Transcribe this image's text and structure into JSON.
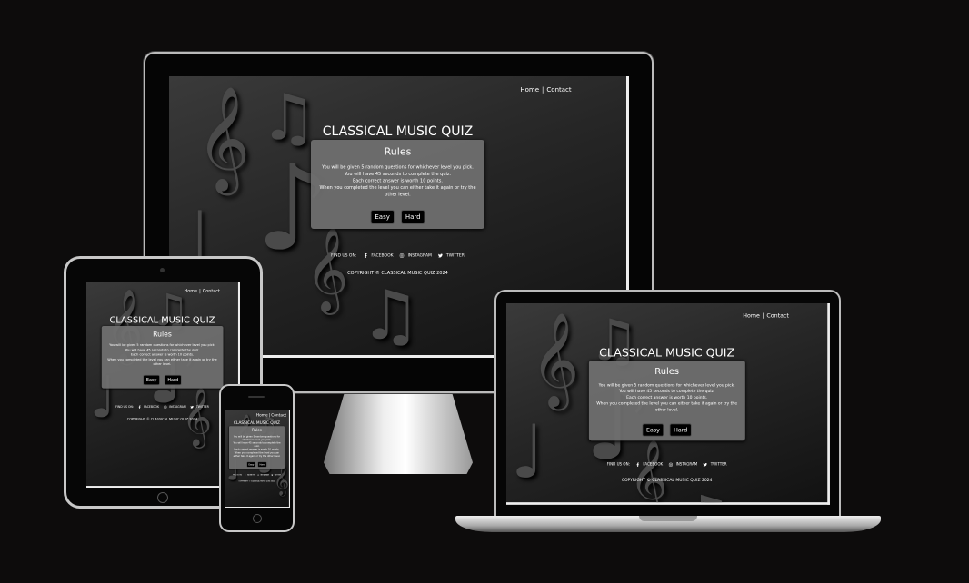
{
  "site": {
    "nav": [
      {
        "label": "Home"
      },
      {
        "label": "Contact"
      }
    ],
    "nav_separator": "|",
    "title": "CLASSICAL MUSIC QUIZ",
    "rules": {
      "heading": "Rules",
      "lines": [
        "You will be given 5 random questions for whichever level you pick.",
        "You will have 45 seconds to complete the quiz.",
        "Each correct answer is worth 10 points.",
        "When you completed the level you can either take it again or try the other level."
      ],
      "easy_label": "Easy",
      "hard_label": "Hard"
    },
    "footer": {
      "find_us": "FIND US ON:",
      "links": [
        {
          "label": "FACEBOOK",
          "icon": "facebook-icon"
        },
        {
          "label": "INSTAGRAM",
          "icon": "instagram-icon"
        },
        {
          "label": "TWITTER",
          "icon": "twitter-icon"
        }
      ],
      "copyright": "COPYRIGHT © CLASSICAL MUSIC QUIZ 2024"
    }
  }
}
